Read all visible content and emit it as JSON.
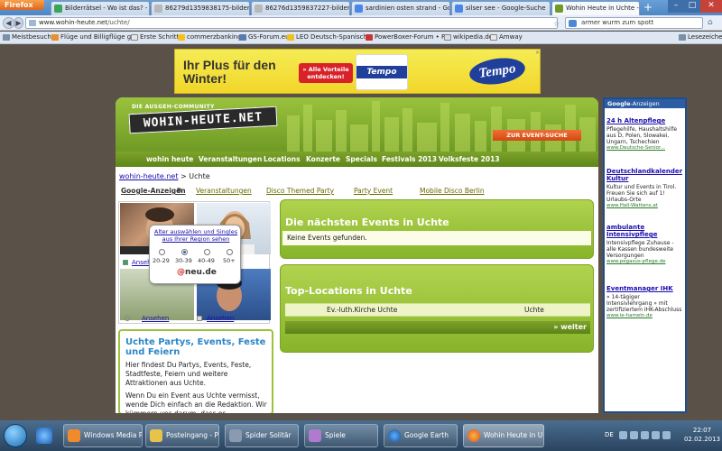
{
  "browser": {
    "menu_button": "Firefox",
    "tabs": [
      {
        "title": "Bilderrätsel - Wo ist das? - S...",
        "icon": "c-favicon-green",
        "active": false
      },
      {
        "title": "86279d1359838175-bilderra...",
        "icon": "image-favicon",
        "active": false
      },
      {
        "title": "86276d1359837227-bilderra...",
        "icon": "image-favicon",
        "active": false
      },
      {
        "title": "sardinien osten strand - Go...",
        "icon": "google-favicon",
        "active": false
      },
      {
        "title": "silser see - Google-Suche",
        "icon": "google-favicon",
        "active": false
      },
      {
        "title": "Wohin Heute in Uchte - Eve...",
        "icon": "wohin-favicon",
        "active": true
      }
    ],
    "new_tab": "+",
    "url_host": "www.wohin-heute.net",
    "url_path": "/uchte/",
    "search_query": "armer wurm zum spott",
    "bookmarks": [
      {
        "label": "Meistbesucht",
        "icon": "gear-icon"
      },
      {
        "label": "Flüge und Billigflüge g...",
        "icon": "plane-icon"
      },
      {
        "label": "Erste Schritte",
        "icon": "page-icon"
      },
      {
        "label": "commerzbanking",
        "icon": "bank-icon"
      },
      {
        "label": "GS-Forum.eu",
        "icon": "forum-icon"
      },
      {
        "label": "LEO Deutsch-Spanisch...",
        "icon": "leo-icon"
      },
      {
        "label": "PowerBoxer-Forum • F...",
        "icon": "forum-icon"
      },
      {
        "label": "wikipedia.de",
        "icon": "wiki-icon"
      },
      {
        "label": "Amway",
        "icon": "page-icon"
      }
    ],
    "bookmarks_right": "Lesezeichen"
  },
  "ad_banner": {
    "headline": "Ihr Plus für den Winter!",
    "cta": "» Alle Vorteile entdecken!",
    "pack_brand": "Tempo",
    "logo": "Tempo"
  },
  "site": {
    "tagline": "DIE AUSGEH-COMMUNITY",
    "logo": "WOHIN-HEUTE.NET",
    "event_search_button": "ZUR EVENT-SUCHE",
    "nav": [
      "wohin heute",
      "Veranstaltungen",
      "Locations",
      "Konzerte",
      "Specials",
      "Festivals 2013",
      "Volksfeste 2013"
    ],
    "breadcrumb": {
      "home": "wohin-heute.net",
      "sep": " > ",
      "current": "Uchte"
    },
    "google_ads_label": "Google-Anzeigen",
    "ad_links": [
      "Veranstaltungen",
      "Disco Themed Party",
      "Party Event",
      "Mobile Disco Berlin"
    ],
    "photo_widget": {
      "labels": [
        "Ansehen",
        "Ansehen",
        "Ansehen"
      ],
      "popup_title": "Alter auswählen und Singles aus Ihrer Region sehen",
      "ages": [
        "20-29",
        "30-39",
        "40-49",
        "50+"
      ],
      "selected_age": "30-39",
      "brand": "neu.de",
      "brand_at": "@"
    },
    "info": {
      "title": "Uchte Partys, Events, Feste und Feiern",
      "p1": "Hier findest Du Partys, Events, Feste, Stadtfeste, Feiern und weitere Attraktionen aus Uchte.",
      "p2": "Wenn Du ein Event aus Uchte vermisst, wende Dich einfach an die Redaktion. Wir kümmern uns darum, dass es schnellstmöglich eingetragen wird."
    },
    "events_panel": {
      "title": "Die nächsten Events in Uchte",
      "empty": "Keine Events gefunden."
    },
    "locations_panel": {
      "title": "Top-Locations in Uchte",
      "rows": [
        {
          "name": "Ev.-luth.Kirche Uchte",
          "city": "Uchte"
        }
      ],
      "more": "» weiter"
    }
  },
  "sidebar": {
    "header_logo": "Google",
    "header": "-Anzeigen",
    "ads": [
      {
        "title": "24 h Altenpflege",
        "text": "Pflegehilfe, Haushaltshilfe aus D, Polen, Slowakei, Ungarn, Tschechien",
        "url": "www.Deutsche-Senior..."
      },
      {
        "title": "Deutschlandkalender Kultur",
        "text": "Kultur und Events in Tirol. Freuen Sie sich auf 1! Urlaubs-Orte",
        "url": "www.Hall-Wattens.at"
      },
      {
        "title": "ambulante Intensivpflege",
        "text": "Intensivpflege Zuhause - alle Kassen bundesweite Versorgungen",
        "url": "www.pegasus-pflege.de"
      },
      {
        "title": "Eventmanager IHK",
        "text": "» 14-tägiger Intensivlehrgang » mit zertifiziertem IHK-Abschluss",
        "url": "www.ie-hameln.de"
      }
    ]
  },
  "taskbar": {
    "buttons": [
      {
        "label": "Windows Media P...",
        "icon": "media-player-icon",
        "active": false
      },
      {
        "label": "Posteingang - Per...",
        "icon": "mail-icon",
        "active": false
      },
      {
        "label": "Spider Solitär",
        "icon": "solitaire-icon",
        "active": false
      },
      {
        "label": "Spiele",
        "icon": "games-icon",
        "active": false
      },
      {
        "label": "Google Earth",
        "icon": "earth-icon",
        "active": false
      },
      {
        "label": "Wohin Heute in U...",
        "icon": "firefox-icon",
        "active": true
      }
    ],
    "lang": "DE",
    "time": "22:07",
    "date": "02.02.2013"
  }
}
